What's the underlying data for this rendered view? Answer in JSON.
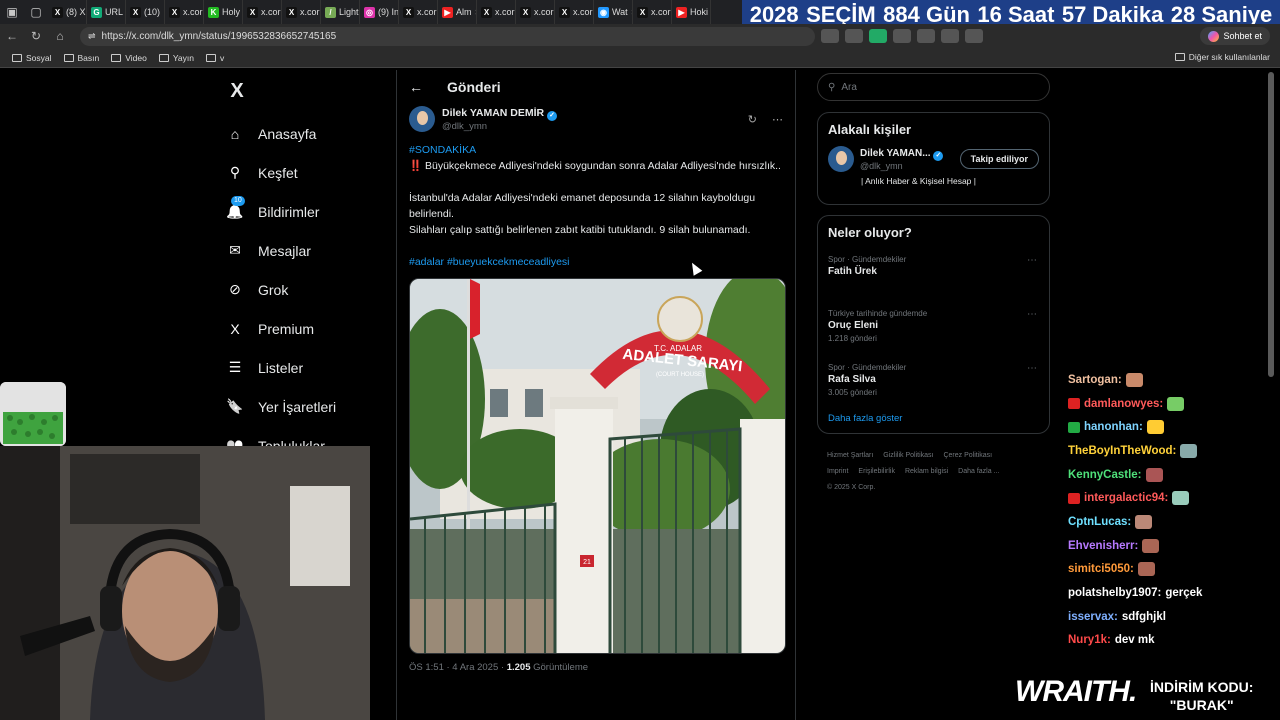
{
  "browser": {
    "tabs": [
      {
        "label": "(8) X",
        "fav": "X",
        "color": "#111"
      },
      {
        "label": "URL",
        "fav": "G",
        "color": "#1a7"
      },
      {
        "label": "(10)",
        "fav": "X",
        "color": "#111"
      },
      {
        "label": "x.cor",
        "fav": "X",
        "color": "#111"
      },
      {
        "label": "Holy",
        "fav": "K",
        "color": "#2b2"
      },
      {
        "label": "x.cor",
        "fav": "X",
        "color": "#111"
      },
      {
        "label": "x.cor",
        "fav": "X",
        "color": "#111"
      },
      {
        "label": "Light",
        "fav": "/",
        "color": "#7a5"
      },
      {
        "label": "(9) In",
        "fav": "◎",
        "color": "#d3a"
      },
      {
        "label": "x.cor",
        "fav": "X",
        "color": "#111"
      },
      {
        "label": "Alm",
        "fav": "▶",
        "color": "#e22"
      },
      {
        "label": "x.cor",
        "fav": "X",
        "color": "#111"
      },
      {
        "label": "x.cor",
        "fav": "X",
        "color": "#111"
      },
      {
        "label": "x.cor",
        "fav": "X",
        "color": "#111"
      },
      {
        "label": "Wat",
        "fav": "◉",
        "color": "#29f"
      },
      {
        "label": "x.cor",
        "fav": "X",
        "color": "#111"
      },
      {
        "label": "Hoki",
        "fav": "▶",
        "color": "#e22"
      }
    ],
    "countdown": {
      "year": "2028",
      "label": "SEÇİM",
      "days": "884 Gün",
      "hours": "16 Saat",
      "minutes": "57 Dakika",
      "seconds": "28 Saniye"
    },
    "url": "https://x.com/dlk_ymn/status/1996532836652745165",
    "chat_button": "Sohbet et",
    "bookmarks": [
      "Sosyal",
      "Basın",
      "Video",
      "Yayın",
      "v"
    ],
    "bookmarks_other": "Diğer sık kullanılanlar"
  },
  "nav": {
    "logo": "X",
    "items": [
      {
        "label": "Anasayfa",
        "icon": "home-icon",
        "glyph": "⌂"
      },
      {
        "label": "Keşfet",
        "icon": "search-icon",
        "glyph": "⚲"
      },
      {
        "label": "Bildirimler",
        "icon": "bell-icon",
        "glyph": "🔔",
        "badge": "10"
      },
      {
        "label": "Mesajlar",
        "icon": "mail-icon",
        "glyph": "✉"
      },
      {
        "label": "Grok",
        "icon": "grok-icon",
        "glyph": "⊘"
      },
      {
        "label": "Premium",
        "icon": "x-premium-icon",
        "glyph": "X"
      },
      {
        "label": "Listeler",
        "icon": "list-icon",
        "glyph": "☰"
      },
      {
        "label": "Yer İşaretleri",
        "icon": "bookmark-icon",
        "glyph": "🔖"
      },
      {
        "label": "Topluluklar",
        "icon": "people-icon",
        "glyph": "👥"
      }
    ]
  },
  "post": {
    "header": "Gönderi",
    "author_name": "Dilek YAMAN DEMİR",
    "author_handle": "@dlk_ymn",
    "tag": "#SONDAKİKA",
    "line1": "‼️ Büyükçekmece Adliyesi'ndeki soygundan sonra Adalar Adliyesi'nde hırsızlık..",
    "line2": "İstanbul'da Adalar Adliyesi'ndeki emanet deposunda 12 silahın kayboldugu belirlendi.",
    "line3": "Silahları çalıp sattığı belirlenen zabıt katibi tutuklandı. 9 silah bulunamadı.",
    "hashtags": "#adalar #bueyuekcekmeceadliyesi",
    "photo": {
      "sign_top": "T.C. ADALAR",
      "sign_main": "ADALET SARAYI",
      "sign_sub": "(COURT HOUSE)",
      "post_number": "21"
    },
    "time": "ÖS 1:51 · 4 Ara 2025 · ",
    "views": "1.205",
    "views_label": " Görüntüleme"
  },
  "sidebar": {
    "search_placeholder": "Ara",
    "related_title": "Alakalı kişiler",
    "related_name": "Dilek YAMAN...",
    "related_handle": "@dlk_ymn",
    "related_follow": "Takip ediliyor",
    "related_bio": "| Anlık Haber & Kişisel Hesap |",
    "trends_title": "Neler oluyor?",
    "trends": [
      {
        "category": "Spor · Gündemdekiler",
        "title": "Fatih Ürek",
        "count": ""
      },
      {
        "category": "Türkiye tarihinde gündemde",
        "title": "Oruç Eleni",
        "count": "1.218 gönderi"
      },
      {
        "category": "Spor · Gündemdekiler",
        "title": "Rafa Silva",
        "count": "3.005 gönderi"
      }
    ],
    "show_more": "Daha fazla göster",
    "footer": [
      "Hizmet Şartları",
      "Gizlilik Politikası",
      "Çerez Politikası",
      "Imprint",
      "Erişilebilirlik",
      "Reklam bilgisi",
      "Daha fazla ...",
      "© 2025 X Corp."
    ]
  },
  "chat": [
    {
      "user": "Sartogan:",
      "msg": "",
      "color": "#f0c0a0",
      "emote": "#c98a6a",
      "badge": ""
    },
    {
      "user": "damlanowyes:",
      "msg": "",
      "color": "#ff5a5a",
      "emote": "#7c6",
      "badge": "#d22"
    },
    {
      "user": "hanonhan:",
      "msg": "",
      "color": "#7fd4ff",
      "emote": "#fc3",
      "badge": "#2a4"
    },
    {
      "user": "TheBoyInTheWood:",
      "msg": "",
      "color": "#ffd23a",
      "emote": "#8aa",
      "badge": ""
    },
    {
      "user": "KennyCastle:",
      "msg": "",
      "color": "#4fe07a",
      "emote": "#a55",
      "badge": ""
    },
    {
      "user": "intergalactic94:",
      "msg": "",
      "color": "#ff5a5a",
      "emote": "#9cb",
      "badge": "#d22"
    },
    {
      "user": "CptnLucas:",
      "msg": "",
      "color": "#6fe0ff",
      "emote": "#b87",
      "badge": ""
    },
    {
      "user": "Ehvenisherr:",
      "msg": "",
      "color": "#b77aff",
      "emote": "#a65",
      "badge": ""
    },
    {
      "user": "simitci5050:",
      "msg": "",
      "color": "#ff9a3a",
      "emote": "#a65",
      "badge": ""
    },
    {
      "user": "polatshelby1907:",
      "msg": "gerçek",
      "color": "#ffffff",
      "emote": "",
      "badge": ""
    },
    {
      "user": "isservax:",
      "msg": "sdfghjkl",
      "color": "#7fb0ff",
      "emote": "",
      "badge": ""
    },
    {
      "user": "Nury1k:",
      "msg": "dev mk",
      "color": "#ff4a4a",
      "emote": "",
      "badge": ""
    }
  ],
  "overlay": {
    "brand": "WRAITH.",
    "promo_line1": "İNDİRİM KODU:",
    "promo_line2": "\"BURAK\""
  }
}
